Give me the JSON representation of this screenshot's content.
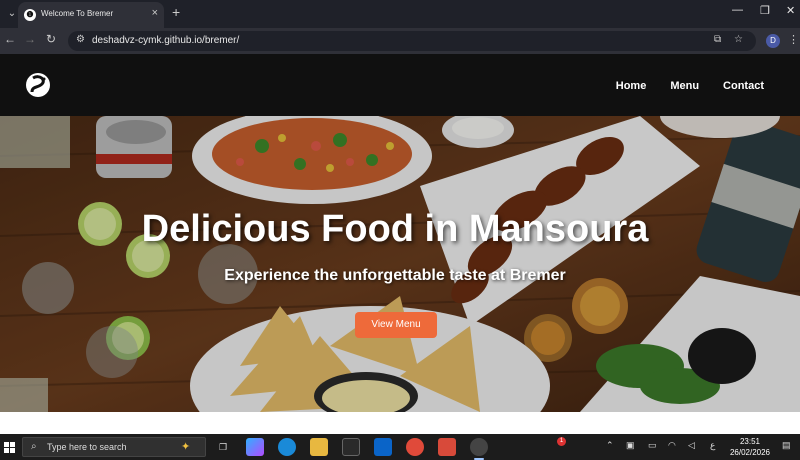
{
  "browser": {
    "tab": {
      "title": "Welcome To Bremer",
      "close_glyph": "×"
    },
    "new_tab_glyph": "+",
    "window_controls": {
      "minimize": "—",
      "maximize": "❐",
      "close": "✕"
    },
    "nav": {
      "back": "←",
      "forward": "→",
      "reload": "↻"
    },
    "address": {
      "url": "deshadvz-cymk.github.io/bremer/"
    },
    "profile_initial": "D",
    "menu_glyph": "⋮"
  },
  "site": {
    "nav_items": [
      "Home",
      "Menu",
      "Contact"
    ],
    "hero": {
      "title": "Delicious Food in Mansoura",
      "subtitle": "Experience the unforgettable taste at Bremer",
      "cta_label": "View Menu"
    },
    "colors": {
      "header_bg": "#101010",
      "cta": "#ee6a3a",
      "wood": "#5a3319"
    }
  },
  "taskbar": {
    "search_placeholder": "Type here to search",
    "notification_count": "1",
    "language": "ع",
    "time": "23:51",
    "date": "26/02/2026"
  }
}
